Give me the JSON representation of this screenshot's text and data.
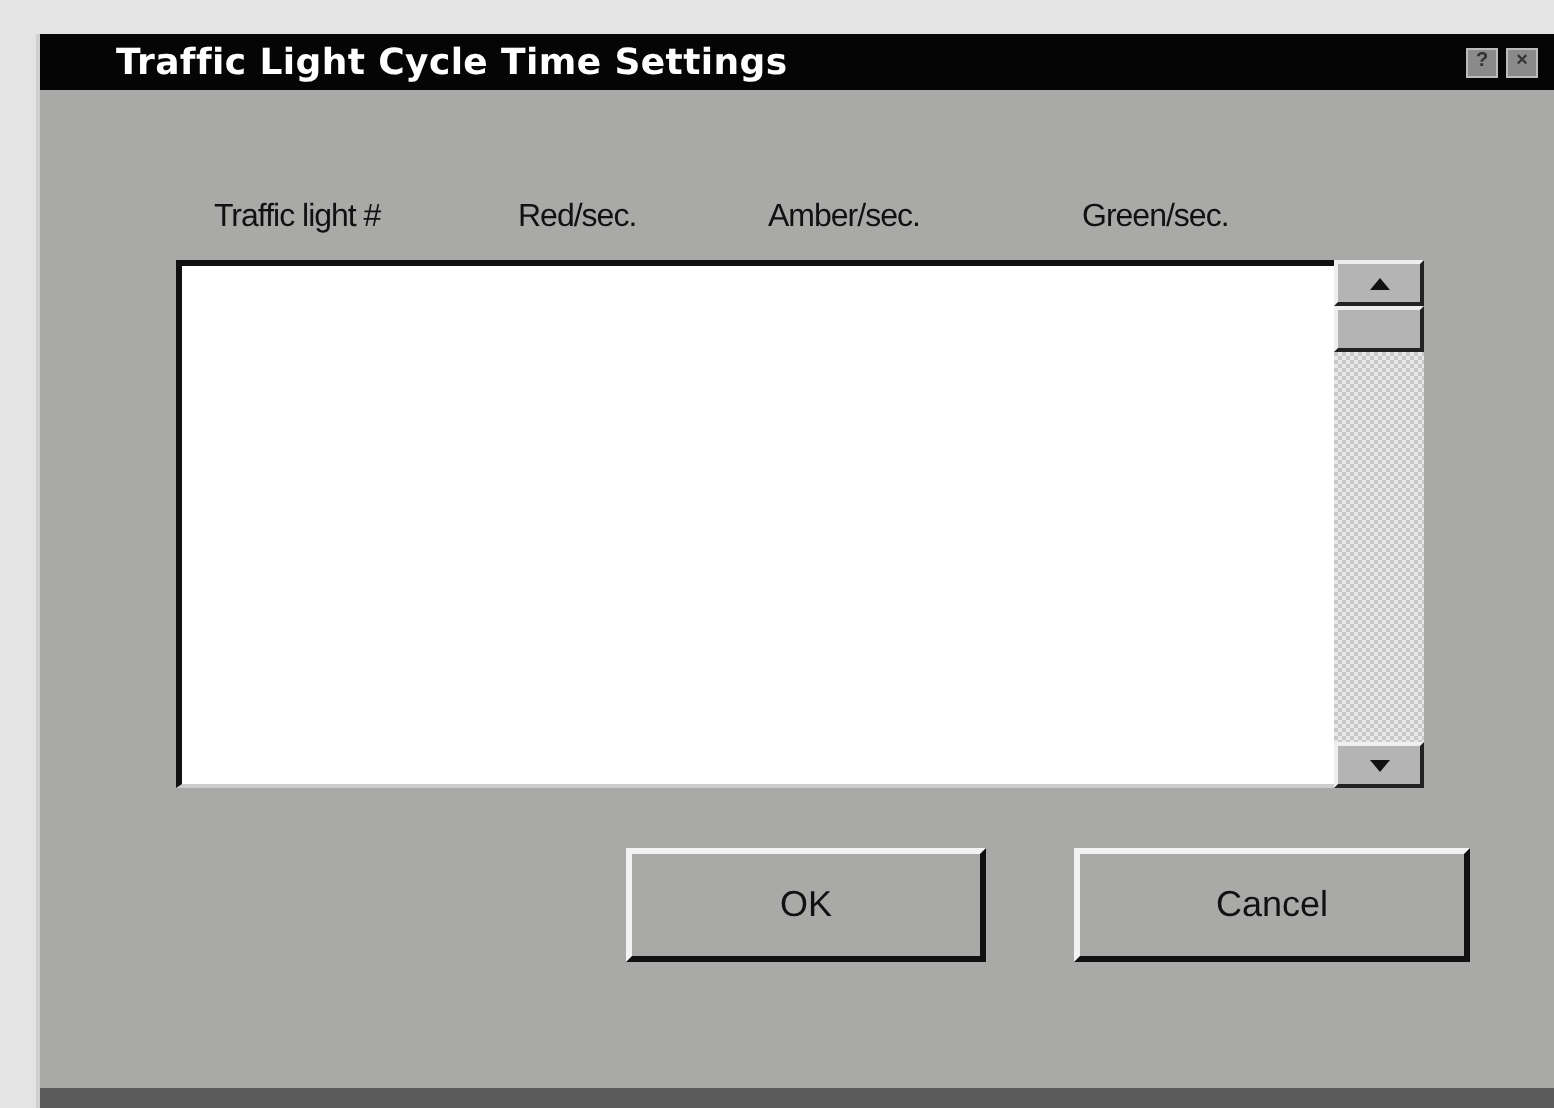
{
  "window": {
    "title": "Traffic Light Cycle Time Settings",
    "title_buttons": [
      "?",
      "×"
    ]
  },
  "columns": [
    "Traffic light #",
    "Red/sec.",
    "Amber/sec.",
    "Green/sec."
  ],
  "buttons": [
    "OK",
    "Cancel"
  ]
}
